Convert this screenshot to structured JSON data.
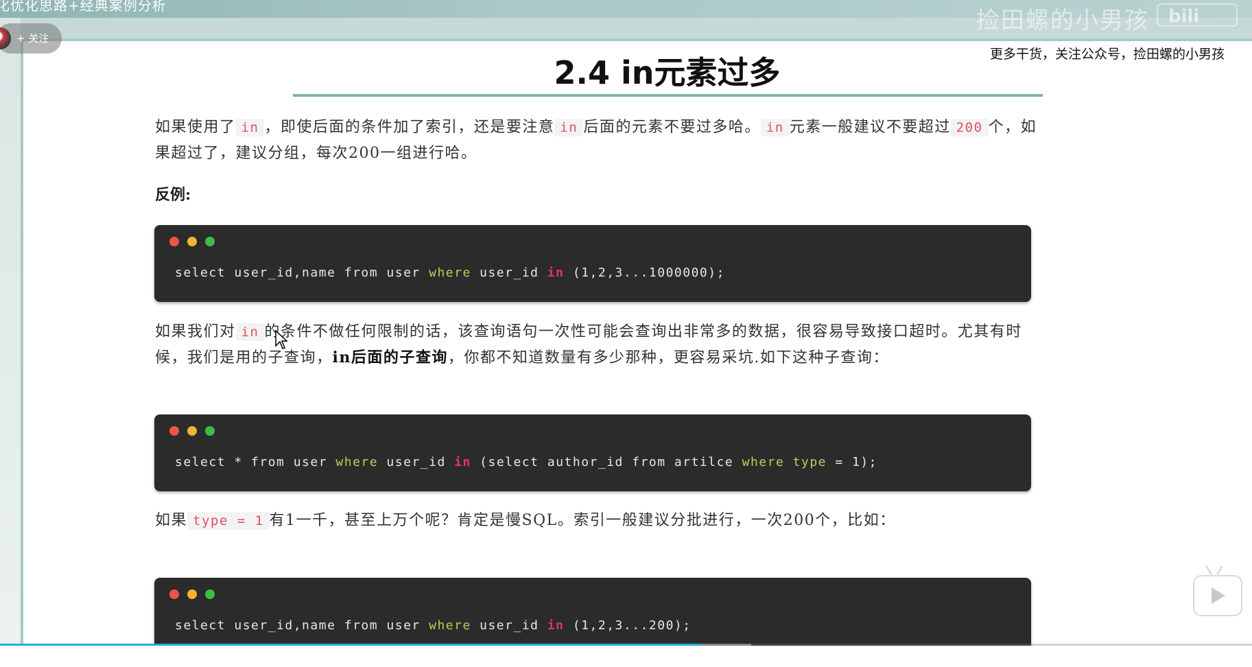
{
  "topbar": {
    "title": "化优化思路+经典案例分析",
    "watermark": "捡田螺的小男孩",
    "logo": "bili"
  },
  "follow": {
    "label": "+ 关注"
  },
  "subscribe_note": "更多干货，关注公众号，捡田螺的小男孩",
  "heading": "2.4 in元素过多",
  "para1": {
    "t1": "如果使用了",
    "c1": "in",
    "t2": "，即使后面的条件加了索引，还是要注意",
    "c2": "in",
    "t3": "后面的元素不要过多哈。",
    "c3": "in",
    "t4": "元素一般建议不要超过",
    "c4": "200",
    "t5": "个，如果超过了，建议分组，每次200一组进行哈。"
  },
  "counter_example_label": "反例:",
  "code1": {
    "p1": "select user_id,name from user ",
    "kw1": "where",
    "p2": " user_id ",
    "in": "in",
    "p3": " (1,2,3...1000000);"
  },
  "para2": {
    "t1": "如果我们对",
    "c1": "in",
    "t2": "的条件不做任何限制的话，该查询语句一次性可能会查询出非常多的数据，很容易导致接口超时。尤其有时候，我们是用的子查询，",
    "strong": "in后面的子查询",
    "t3": "，你都不知道数量有多少那种，更容易采坑.如下这种子查询："
  },
  "code2": {
    "p1": "select * from user ",
    "kw1": "where",
    "p2": " user_id ",
    "in": "in",
    "p3": " (select author_id from artilce ",
    "kw2": "where",
    "p4": " ",
    "kw3": "type",
    "p5": " = 1);"
  },
  "para3": {
    "t1": "如果",
    "c1": "type = 1",
    "t2": "有1一千，甚至上万个呢？肯定是慢SQL。索引一般建议分批进行，一次200个，比如："
  },
  "code3": {
    "p1": "select user_id,name from user ",
    "kw1": "where",
    "p2": " user_id ",
    "in": "in",
    "p3": " (1,2,3...200);"
  },
  "player": {
    "progress_fraction": 0.56,
    "buffer_fraction": 0.6
  },
  "colors": {
    "code_bg": "#2b2b2b",
    "keyword": "#b5d15a",
    "in_keyword": "#e5336b",
    "inline_code": "#e0505e",
    "accent_rule": "#7fb4ae",
    "progress": "#23ade5"
  }
}
